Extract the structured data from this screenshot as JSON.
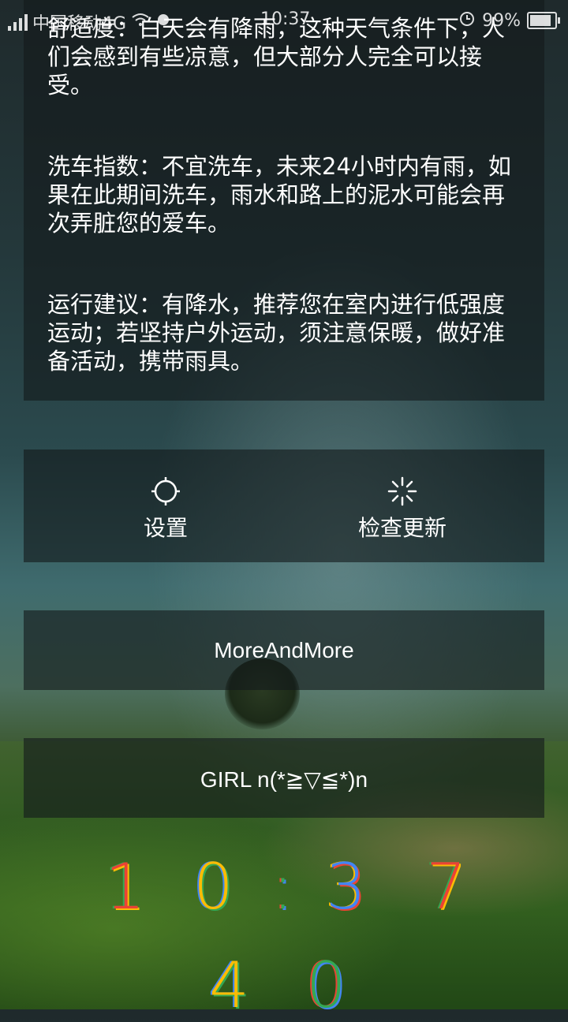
{
  "status_bar": {
    "carrier": "中国移动4G",
    "time": "10:37",
    "battery": "99%",
    "battery_level": 0.99
  },
  "tips": [
    "舒适度：白天会有降雨，这种天气条件下，人们会感到有些凉意，但大部分人完全可以接受。",
    "洗车指数：不宜洗车，未来24小时内有雨，如果在此期间洗车，雨水和路上的泥水可能会再次弄脏您的爱车。",
    "运行建议：有降水，推荐您在室内进行低强度运动；若坚持户外运动，须注意保暖，做好准备活动，携带雨具。"
  ],
  "actions": {
    "settings_label": "设置",
    "settings_icon": "gear-icon",
    "update_label": "检查更新",
    "update_icon": "loading-icon"
  },
  "more_label": "MoreAndMore",
  "girl_label": "GIRL  n(*≧▽≦*)n",
  "clock": {
    "digits": [
      "1",
      "0",
      ":",
      "3",
      "7",
      "4",
      "0"
    ],
    "colors": [
      "#ea4335",
      "#fbbc05",
      "#34a853",
      "#4285f4"
    ]
  }
}
